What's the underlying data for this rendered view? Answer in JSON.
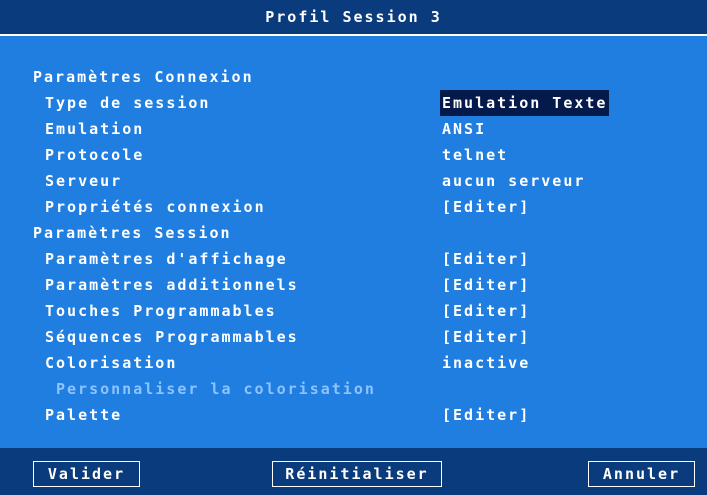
{
  "window": {
    "title": "Profil Session 3"
  },
  "sections": {
    "connexion": "Paramètres Connexion",
    "session": "Paramètres Session"
  },
  "rows": [
    {
      "label": "Type de session",
      "value": "Emulation Texte",
      "selected": true
    },
    {
      "label": "Emulation",
      "value": "ANSI"
    },
    {
      "label": "Protocole",
      "value": "telnet"
    },
    {
      "label": "Serveur",
      "value": "aucun serveur"
    },
    {
      "label": "Propriétés connexion",
      "value": "[Editer]"
    },
    {
      "label": "Paramètres d'affichage",
      "value": "[Editer]"
    },
    {
      "label": "Paramètres additionnels",
      "value": "[Editer]"
    },
    {
      "label": "Touches Programmables",
      "value": "[Editer]"
    },
    {
      "label": "Séquences Programmables",
      "value": "[Editer]"
    },
    {
      "label": "Colorisation",
      "value": "inactive"
    },
    {
      "label": "Personnaliser la colorisation",
      "value": "",
      "disabled": true
    },
    {
      "label": "Palette",
      "value": "[Editer]"
    }
  ],
  "buttons": {
    "validate": "Valider",
    "reset": "Réinitialiser",
    "cancel": "Annuler"
  },
  "colors": {
    "background": "#1f7ee0",
    "titlebar": "#0a3b7d",
    "selection": "#041a4a",
    "disabled_text": "#8cc4ff"
  }
}
